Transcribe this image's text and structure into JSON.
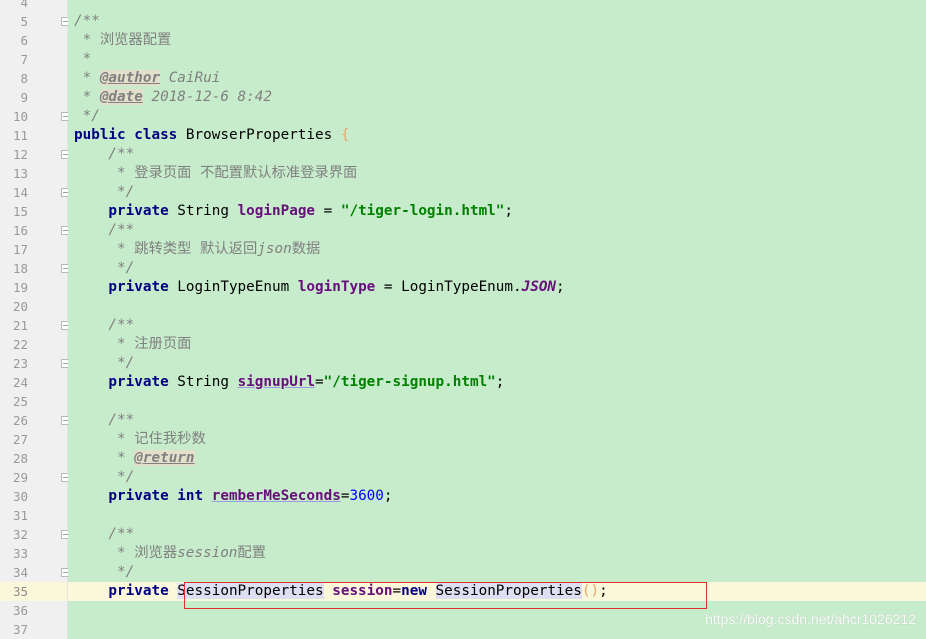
{
  "editor": {
    "current_line": 35,
    "lines": [
      {
        "n": "4",
        "fold": "",
        "tokens": []
      },
      {
        "n": "5",
        "fold": "start",
        "tokens": [
          {
            "t": "/**",
            "c": "cm"
          }
        ]
      },
      {
        "n": "6",
        "fold": "",
        "tokens": [
          {
            "t": " * ",
            "c": "cm"
          },
          {
            "t": "浏览器配置",
            "c": "cmtext"
          }
        ]
      },
      {
        "n": "7",
        "fold": "",
        "tokens": [
          {
            "t": " *",
            "c": "cm"
          }
        ]
      },
      {
        "n": "8",
        "fold": "",
        "tokens": [
          {
            "t": " * ",
            "c": "cm"
          },
          {
            "t": "@author",
            "c": "tag"
          },
          {
            "t": " CaiRui",
            "c": "tagval"
          }
        ]
      },
      {
        "n": "9",
        "fold": "",
        "tokens": [
          {
            "t": " * ",
            "c": "cm"
          },
          {
            "t": "@date",
            "c": "tag"
          },
          {
            "t": " 2018-12-6 8:42",
            "c": "tagval"
          }
        ]
      },
      {
        "n": "10",
        "fold": "end",
        "tokens": [
          {
            "t": " */",
            "c": "cm"
          }
        ]
      },
      {
        "n": "11",
        "fold": "",
        "tokens": [
          {
            "t": "public class ",
            "c": "kw"
          },
          {
            "t": "BrowserProperties ",
            "c": "plain"
          },
          {
            "t": "{",
            "c": "brace"
          }
        ]
      },
      {
        "n": "12",
        "fold": "start",
        "tokens": [
          {
            "t": "    /**",
            "c": "cm"
          }
        ]
      },
      {
        "n": "13",
        "fold": "",
        "tokens": [
          {
            "t": "     * ",
            "c": "cm"
          },
          {
            "t": "登录页面 不配置默认标准登录界面",
            "c": "cmtext"
          }
        ]
      },
      {
        "n": "14",
        "fold": "end",
        "tokens": [
          {
            "t": "     */",
            "c": "cm"
          }
        ]
      },
      {
        "n": "15",
        "fold": "",
        "tokens": [
          {
            "t": "    private ",
            "c": "kw"
          },
          {
            "t": "String ",
            "c": "plain"
          },
          {
            "t": "loginPage",
            "c": "field"
          },
          {
            "t": " = ",
            "c": "plain"
          },
          {
            "t": "\"/tiger-login.html\"",
            "c": "str"
          },
          {
            "t": ";",
            "c": "plain"
          }
        ]
      },
      {
        "n": "16",
        "fold": "start",
        "tokens": [
          {
            "t": "    /**",
            "c": "cm"
          }
        ]
      },
      {
        "n": "17",
        "fold": "",
        "tokens": [
          {
            "t": "     * ",
            "c": "cm"
          },
          {
            "t": "跳转类型 默认返回",
            "c": "cmtext"
          },
          {
            "t": "json",
            "c": "cm"
          },
          {
            "t": "数据",
            "c": "cmtext"
          }
        ]
      },
      {
        "n": "18",
        "fold": "end",
        "tokens": [
          {
            "t": "     */",
            "c": "cm"
          }
        ]
      },
      {
        "n": "19",
        "fold": "",
        "tokens": [
          {
            "t": "    private ",
            "c": "kw"
          },
          {
            "t": "LoginTypeEnum ",
            "c": "plain"
          },
          {
            "t": "loginType",
            "c": "field"
          },
          {
            "t": " = LoginTypeEnum.",
            "c": "plain"
          },
          {
            "t": "JSON",
            "c": "enumc"
          },
          {
            "t": ";",
            "c": "plain"
          }
        ]
      },
      {
        "n": "20",
        "fold": "",
        "tokens": []
      },
      {
        "n": "21",
        "fold": "start",
        "tokens": [
          {
            "t": "    /**",
            "c": "cm"
          }
        ]
      },
      {
        "n": "22",
        "fold": "",
        "tokens": [
          {
            "t": "     * ",
            "c": "cm"
          },
          {
            "t": "注册页面",
            "c": "cmtext"
          }
        ]
      },
      {
        "n": "23",
        "fold": "end",
        "tokens": [
          {
            "t": "     */",
            "c": "cm"
          }
        ]
      },
      {
        "n": "24",
        "fold": "",
        "tokens": [
          {
            "t": "    private ",
            "c": "kw"
          },
          {
            "t": "String ",
            "c": "plain"
          },
          {
            "t": "signupUrl",
            "c": "field-u"
          },
          {
            "t": "=",
            "c": "plain"
          },
          {
            "t": "\"/tiger-signup.html\"",
            "c": "str"
          },
          {
            "t": ";",
            "c": "plain"
          }
        ]
      },
      {
        "n": "25",
        "fold": "",
        "tokens": []
      },
      {
        "n": "26",
        "fold": "start",
        "tokens": [
          {
            "t": "    /**",
            "c": "cm"
          }
        ]
      },
      {
        "n": "27",
        "fold": "",
        "tokens": [
          {
            "t": "     * ",
            "c": "cm"
          },
          {
            "t": "记住我秒数",
            "c": "cmtext"
          }
        ]
      },
      {
        "n": "28",
        "fold": "",
        "tokens": [
          {
            "t": "     * ",
            "c": "cm"
          },
          {
            "t": "@return",
            "c": "tag"
          }
        ]
      },
      {
        "n": "29",
        "fold": "end",
        "tokens": [
          {
            "t": "     */",
            "c": "cm"
          }
        ]
      },
      {
        "n": "30",
        "fold": "",
        "tokens": [
          {
            "t": "    private ",
            "c": "kw"
          },
          {
            "t": "int ",
            "c": "kw"
          },
          {
            "t": "remberMeSeconds",
            "c": "field-u"
          },
          {
            "t": "=",
            "c": "plain"
          },
          {
            "t": "3600",
            "c": "num"
          },
          {
            "t": ";",
            "c": "plain"
          }
        ]
      },
      {
        "n": "31",
        "fold": "",
        "tokens": []
      },
      {
        "n": "32",
        "fold": "start",
        "tokens": [
          {
            "t": "    /**",
            "c": "cm"
          }
        ]
      },
      {
        "n": "33",
        "fold": "",
        "tokens": [
          {
            "t": "     * ",
            "c": "cm"
          },
          {
            "t": "浏览器",
            "c": "cmtext"
          },
          {
            "t": "session",
            "c": "cm"
          },
          {
            "t": "配置",
            "c": "cmtext"
          }
        ]
      },
      {
        "n": "34",
        "fold": "end",
        "tokens": [
          {
            "t": "     */",
            "c": "cm"
          }
        ]
      },
      {
        "n": "35",
        "fold": "",
        "tokens": [
          {
            "t": "    private ",
            "c": "kw"
          },
          {
            "t": "SessionProperties",
            "c": "plain hl"
          },
          {
            "t": " ",
            "c": "plain"
          },
          {
            "t": "session",
            "c": "field"
          },
          {
            "t": "=",
            "c": "plain"
          },
          {
            "t": "new ",
            "c": "kw"
          },
          {
            "t": "SessionProperties",
            "c": "plain hl"
          },
          {
            "t": "()",
            "c": "paren"
          },
          {
            "t": ";",
            "c": "plain"
          }
        ]
      },
      {
        "n": "36",
        "fold": "",
        "tokens": []
      },
      {
        "n": "37",
        "fold": "",
        "tokens": []
      }
    ]
  },
  "watermark": "https://blog.csdn.net/ahcr1026212"
}
